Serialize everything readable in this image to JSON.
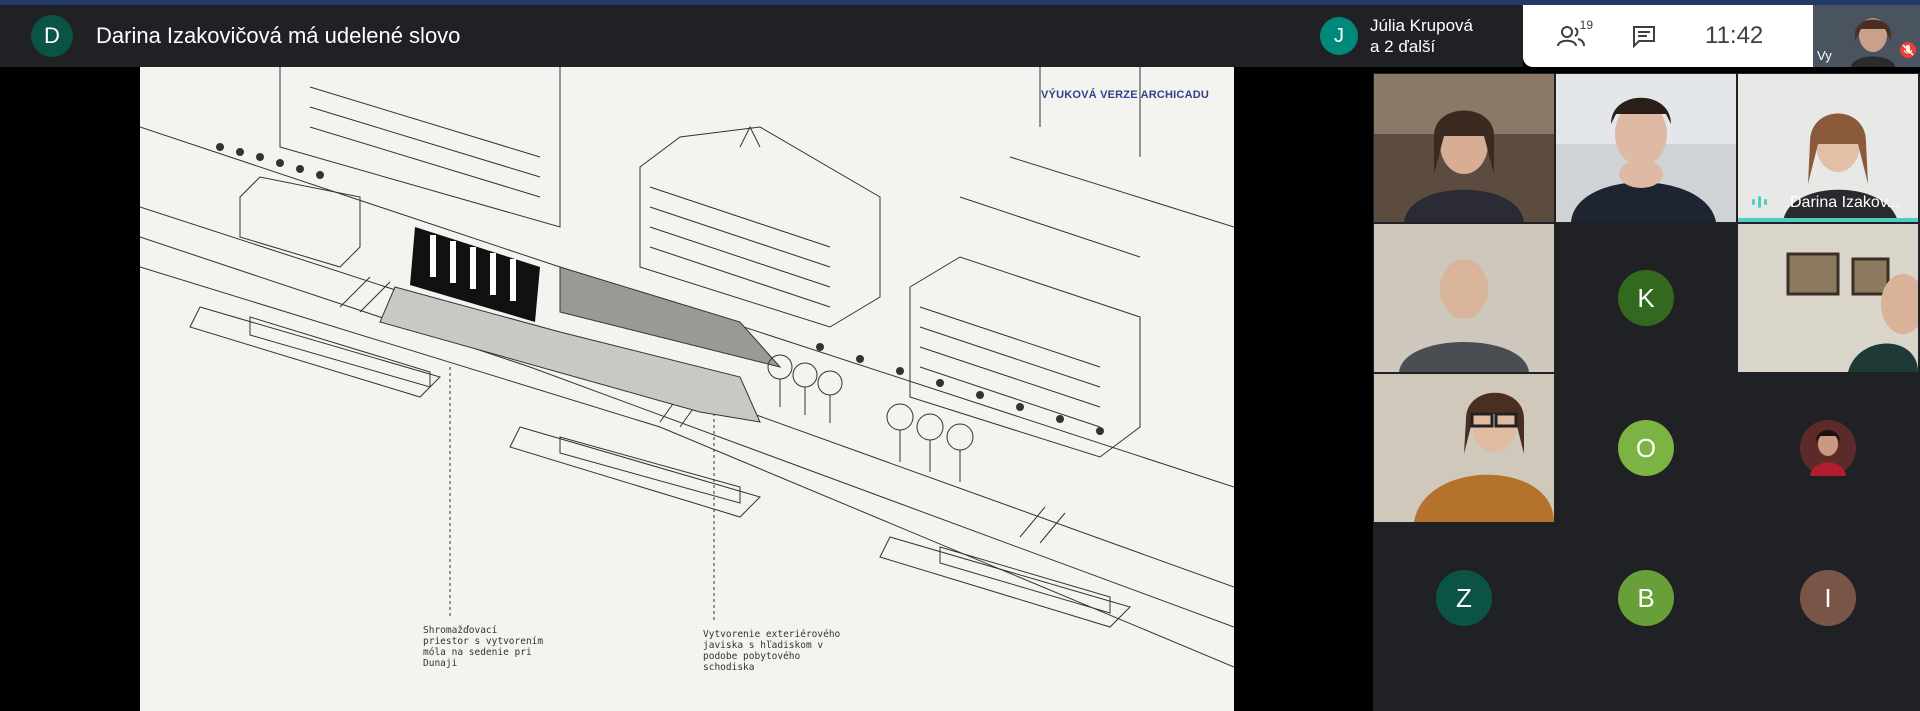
{
  "header": {
    "presenter_initial": "D",
    "title": "Darina Izakovičová má udelené slovo"
  },
  "slide": {
    "watermark": "VÝUKOVÁ VERZE ARCHICADU",
    "annotation_1": "Shromažďovací\npriestor s vytvorením\nmóla na sedenie pri\nDunaji",
    "annotation_2": "Vytvorenie exteriérového\njaviska s hľadiskom v\npodobe pobytového\nschodiska"
  },
  "participants_chip": {
    "initial": "J",
    "line1": "Júlia Krupová",
    "line2": "a 2 ďalší"
  },
  "controls": {
    "people_count": "19",
    "clock": "11:42"
  },
  "self_tile": {
    "label": "Vy"
  },
  "tiles": [
    {
      "kind": "video",
      "tone": "#6b5a4c"
    },
    {
      "kind": "video",
      "tone": "#4a4e5a"
    },
    {
      "kind": "video",
      "tone": "#c9c4bf",
      "name": "Darina Izakov...",
      "speaking": true
    },
    {
      "kind": "video",
      "tone": "#7a736a"
    },
    {
      "kind": "avatar",
      "initial": "K",
      "color": "#33691e"
    },
    {
      "kind": "video",
      "tone": "#d5d0c8"
    },
    {
      "kind": "video",
      "tone": "#8a6b4a"
    },
    {
      "kind": "avatar",
      "initial": "O",
      "color": "#7cb342"
    },
    {
      "kind": "photo",
      "color": "#5d2a2a"
    },
    {
      "kind": "avatar",
      "initial": "Z",
      "color": "#0b5345"
    },
    {
      "kind": "avatar",
      "initial": "B",
      "color": "#689f38"
    },
    {
      "kind": "avatar",
      "initial": "I",
      "color": "#795548"
    }
  ]
}
